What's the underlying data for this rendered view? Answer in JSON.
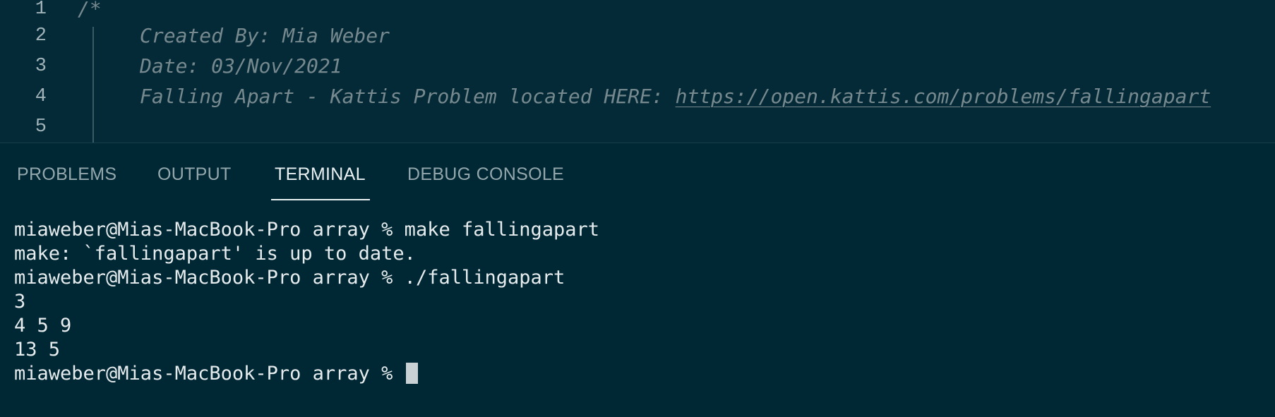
{
  "editor": {
    "lines": [
      {
        "number": "1",
        "text": "/*"
      },
      {
        "number": "2",
        "text": "Created By: Mia Weber"
      },
      {
        "number": "3",
        "text": "Date: 03/Nov/2021"
      },
      {
        "number": "4",
        "text": "Falling Apart - Kattis Problem located HERE: ",
        "url": "https://open.kattis.com/problems/fallingapart"
      },
      {
        "number": "5",
        "text": ""
      }
    ]
  },
  "panel": {
    "tabs": [
      {
        "label": "PROBLEMS"
      },
      {
        "label": "OUTPUT"
      },
      {
        "label": "TERMINAL",
        "active": true
      },
      {
        "label": "DEBUG CONSOLE"
      }
    ]
  },
  "terminal": {
    "lines": [
      "miaweber@Mias-MacBook-Pro array % make fallingapart",
      "make: `fallingapart' is up to date.",
      "miaweber@Mias-MacBook-Pro array % ./fallingapart",
      "3",
      "4 5 9",
      "13 5",
      "miaweber@Mias-MacBook-Pro array % "
    ]
  },
  "colors": {
    "editor_bg": "#052a37",
    "panel_bg": "#002834",
    "comment": "#76898f",
    "terminal_text": "#e6ecee"
  }
}
